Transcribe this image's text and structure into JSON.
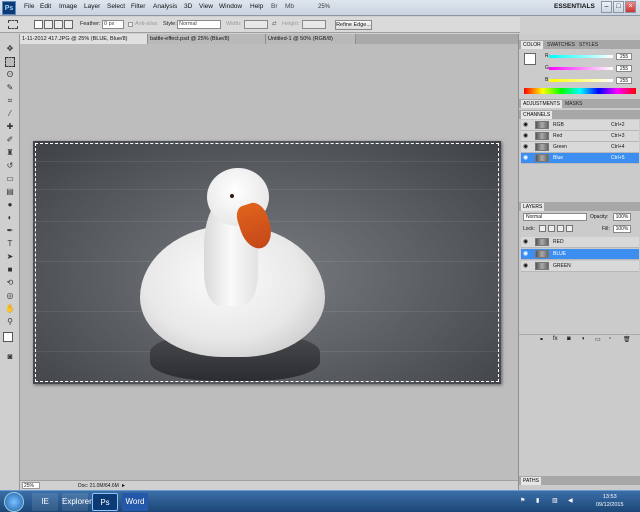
{
  "app": {
    "logo": "Ps",
    "menu": [
      "File",
      "Edit",
      "Image",
      "Layer",
      "Select",
      "Filter",
      "Analysis",
      "3D",
      "View",
      "Window",
      "Help"
    ],
    "zoom": "25%",
    "workspace": "ESSENTIALS",
    "window_controls": [
      "–",
      "□",
      "×"
    ]
  },
  "options_bar": {
    "feather_label": "Feather:",
    "feather_value": "0 px",
    "antialias_label": "Anti-alias",
    "style_label": "Style:",
    "style_value": "Normal",
    "width_label": "Width:",
    "height_label": "Height:",
    "refine_edge": "Refine Edge..."
  },
  "tabs": [
    "1-11-2012 417.JPG @ 25% (BLUE, Blue/8)",
    "battle-effect.psd @ 25% (Blue/8)",
    "Untitled-1 @ 50% (RGB/8)"
  ],
  "status": {
    "zoom": "25%",
    "doc": "Doc: 21.0M/64.6M"
  },
  "color_panel": {
    "tabs": [
      "COLOR",
      "SWATCHES",
      "STYLES"
    ],
    "channels": [
      {
        "label": "R",
        "value": "255",
        "color": "#e02020"
      },
      {
        "label": "G",
        "value": "255",
        "color": "#20c020"
      },
      {
        "label": "B",
        "value": "255",
        "color": "#2040e0"
      }
    ]
  },
  "adjust_panel": {
    "tabs": [
      "ADJUSTMENTS",
      "MASKS"
    ]
  },
  "channels_panel": {
    "title": "CHANNELS",
    "rows": [
      {
        "name": "RGB",
        "shortcut": "Ctrl+2",
        "selected": false
      },
      {
        "name": "Red",
        "shortcut": "Ctrl+3",
        "selected": false
      },
      {
        "name": "Green",
        "shortcut": "Ctrl+4",
        "selected": false
      },
      {
        "name": "Blue",
        "shortcut": "Ctrl+5",
        "selected": true
      }
    ]
  },
  "layers_panel": {
    "title": "LAYERS",
    "blend_mode": "Normal",
    "opacity_label": "Opacity:",
    "opacity": "100%",
    "lock_label": "Lock:",
    "fill_label": "Fill:",
    "fill": "100%",
    "rows": [
      {
        "name": "RED",
        "selected": false
      },
      {
        "name": "BLUE",
        "selected": true
      },
      {
        "name": "GREEN",
        "selected": false
      }
    ]
  },
  "paths_panel": {
    "title": "PATHS"
  },
  "taskbar": {
    "time": "13:53",
    "date": "09/12/2015",
    "apps": [
      "IE",
      "Explorer",
      "Ps",
      "Word"
    ]
  }
}
